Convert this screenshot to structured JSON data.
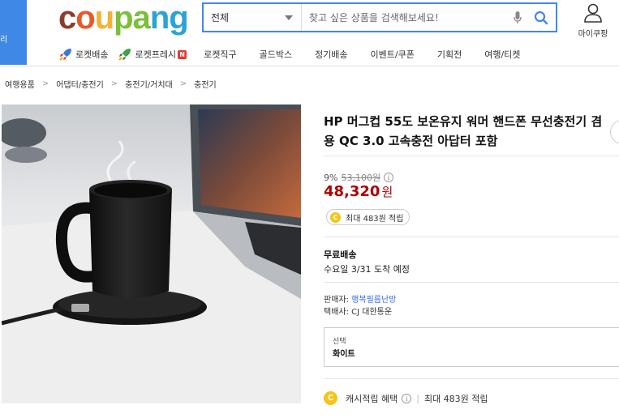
{
  "left_strip": {
    "text": "리"
  },
  "logo": {
    "parts": [
      "c",
      "o",
      "u",
      "pa",
      "ng"
    ]
  },
  "search": {
    "category": "전체",
    "placeholder": "찾고 싶은 상품을 검색해보세요!"
  },
  "header": {
    "mycoupang_label": "마이쿠팡"
  },
  "nav": {
    "items": [
      "로켓배송",
      "로켓프레시",
      "로켓직구",
      "골드박스",
      "정기배송",
      "이벤트/쿠폰",
      "기획전",
      "여행/티켓"
    ],
    "badge": "N"
  },
  "breadcrumb": [
    "여행용품",
    "어댑터/충전기",
    "충전기/거치대",
    "충전기"
  ],
  "product": {
    "title": "HP 머그컵 55도 보온유지 워머 핸드폰 무선충전기 겸용 QC 3.0 고속충전 아답터 포함",
    "discount": "9%",
    "original_price": "53,100원",
    "price": "48,320",
    "price_unit": "원",
    "cash_reward": "최대 483원 적립"
  },
  "shipping": {
    "label": "무료배송",
    "arrival": "수요일 3/31 도착 예정"
  },
  "seller": {
    "label": "판매자:",
    "name": "행복필름난방",
    "courier_label": "택배사:",
    "courier": "CJ 대한통운"
  },
  "option": {
    "label": "선택",
    "value": "화이트"
  },
  "cash_benefit": {
    "label": "캐시적립 혜택",
    "value": "최대 483원 적립",
    "coin": "C"
  },
  "colors": {
    "accent_blue": "#4285f4",
    "price_red": "#ae0000",
    "link_blue": "#346aff",
    "strip_blue": "#3f88e6"
  }
}
